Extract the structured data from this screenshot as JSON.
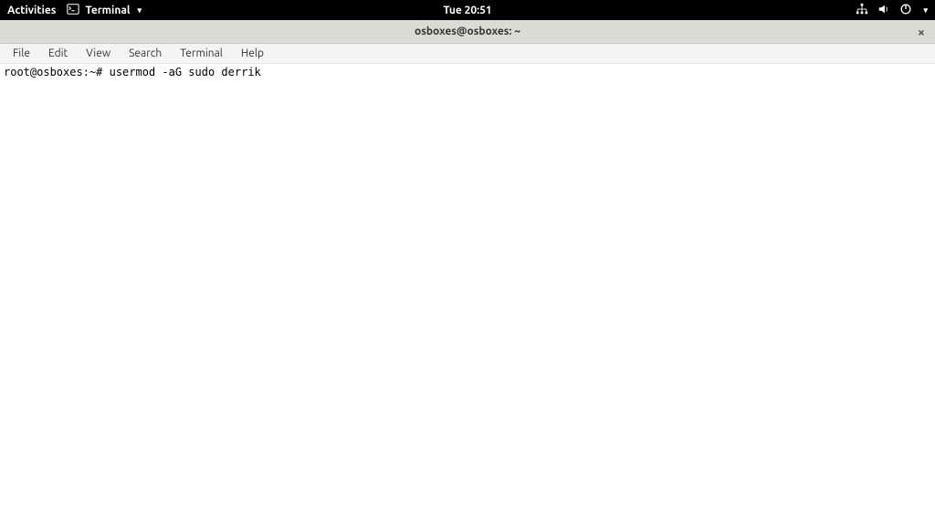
{
  "top_panel": {
    "activities": "Activities",
    "app_name": "Terminal",
    "clock": "Tue 20:51"
  },
  "title_bar": {
    "title": "osboxes@osboxes: ~"
  },
  "menu": {
    "file": "File",
    "edit": "Edit",
    "view": "View",
    "search": "Search",
    "terminal": "Terminal",
    "help": "Help"
  },
  "terminal": {
    "prompt": "root@osboxes:~#",
    "command": "usermod -aG sudo derrik"
  }
}
